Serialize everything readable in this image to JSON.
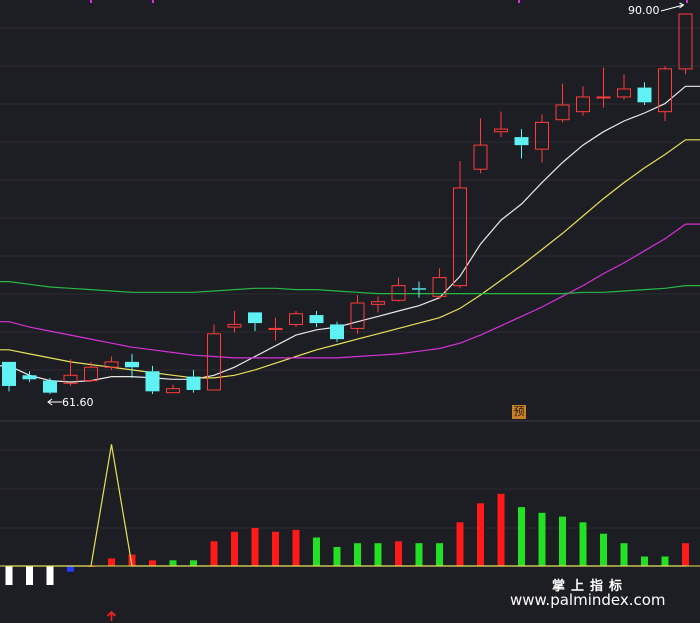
{
  "chart_data": {
    "type": "candlestick",
    "price_range": [
      60,
      92
    ],
    "annotations": {
      "high_label": "90.00",
      "low_label": "61.60",
      "predict_badge": "预"
    },
    "candles": [
      {
        "o": 64.0,
        "c": 62.2,
        "h": 64.0,
        "l": 61.8
      },
      {
        "o": 63.0,
        "c": 62.7,
        "h": 63.3,
        "l": 62.5
      },
      {
        "o": 62.6,
        "c": 61.7,
        "h": 62.8,
        "l": 61.6
      },
      {
        "o": 62.4,
        "c": 63.0,
        "h": 64.2,
        "l": 62.2
      },
      {
        "o": 62.6,
        "c": 63.6,
        "h": 64.0,
        "l": 62.5
      },
      {
        "o": 63.6,
        "c": 64.0,
        "h": 64.4,
        "l": 63.4
      },
      {
        "o": 64.0,
        "c": 63.6,
        "h": 64.6,
        "l": 62.8
      },
      {
        "o": 63.3,
        "c": 61.8,
        "h": 63.7,
        "l": 61.6
      },
      {
        "o": 61.7,
        "c": 62.0,
        "h": 62.3,
        "l": 61.7
      },
      {
        "o": 62.9,
        "c": 61.9,
        "h": 63.4,
        "l": 61.7
      },
      {
        "o": 61.9,
        "c": 66.1,
        "h": 66.8,
        "l": 61.9
      },
      {
        "o": 66.6,
        "c": 66.8,
        "h": 67.8,
        "l": 66.2
      },
      {
        "o": 67.7,
        "c": 66.9,
        "h": 67.7,
        "l": 66.3
      },
      {
        "o": 66.5,
        "c": 66.5,
        "h": 67.3,
        "l": 65.6
      },
      {
        "o": 66.8,
        "c": 67.6,
        "h": 67.8,
        "l": 66.6
      },
      {
        "o": 67.5,
        "c": 66.9,
        "h": 67.8,
        "l": 66.6
      },
      {
        "o": 66.8,
        "c": 65.7,
        "h": 67.0,
        "l": 65.5
      },
      {
        "o": 66.5,
        "c": 68.4,
        "h": 69.0,
        "l": 66.1
      },
      {
        "o": 68.3,
        "c": 68.5,
        "h": 68.9,
        "l": 67.7
      },
      {
        "o": 68.6,
        "c": 69.7,
        "h": 70.3,
        "l": 68.5
      },
      {
        "o": 69.5,
        "c": 69.4,
        "h": 70.0,
        "l": 68.8
      },
      {
        "o": 68.9,
        "c": 70.3,
        "h": 71.0,
        "l": 68.7
      },
      {
        "o": 69.7,
        "c": 77.0,
        "h": 79.0,
        "l": 69.5
      },
      {
        "o": 78.4,
        "c": 80.2,
        "h": 82.2,
        "l": 78.1
      },
      {
        "o": 81.2,
        "c": 81.4,
        "h": 82.7,
        "l": 80.8
      },
      {
        "o": 80.8,
        "c": 80.2,
        "h": 81.4,
        "l": 79.2
      },
      {
        "o": 79.9,
        "c": 81.9,
        "h": 82.5,
        "l": 78.9
      },
      {
        "o": 82.1,
        "c": 83.2,
        "h": 84.8,
        "l": 81.9
      },
      {
        "o": 82.7,
        "c": 83.8,
        "h": 84.6,
        "l": 82.4
      },
      {
        "o": 83.8,
        "c": 83.8,
        "h": 86.0,
        "l": 83.0
      },
      {
        "o": 83.8,
        "c": 84.4,
        "h": 85.5,
        "l": 83.6
      },
      {
        "o": 84.5,
        "c": 83.4,
        "h": 84.9,
        "l": 83.2
      },
      {
        "o": 82.7,
        "c": 85.9,
        "h": 86.1,
        "l": 82.0
      },
      {
        "o": 85.9,
        "c": 90.0,
        "h": 90.0,
        "l": 85.5
      }
    ],
    "ma_lines": [
      {
        "color": "#e8e8e8",
        "values": [
          63.7,
          63.0,
          62.6,
          62.5,
          62.6,
          62.9,
          62.9,
          62.8,
          62.7,
          62.7,
          63.0,
          63.6,
          64.4,
          65.2,
          66.0,
          66.4,
          66.6,
          67.0,
          67.4,
          67.8,
          68.2,
          68.8,
          70.4,
          72.8,
          74.6,
          75.8,
          77.4,
          78.9,
          80.2,
          81.2,
          82.0,
          82.6,
          83.3,
          84.6
        ]
      },
      {
        "color": "#e6e05a",
        "values": [
          64.9,
          64.6,
          64.3,
          64.0,
          63.8,
          63.6,
          63.4,
          63.2,
          63.0,
          62.8,
          62.8,
          63.0,
          63.4,
          63.9,
          64.4,
          64.9,
          65.3,
          65.7,
          66.1,
          66.5,
          66.9,
          67.3,
          68.0,
          69.0,
          70.1,
          71.2,
          72.4,
          73.6,
          74.9,
          76.2,
          77.4,
          78.5,
          79.5,
          80.6
        ]
      },
      {
        "color": "#d531d8",
        "values": [
          67.0,
          66.6,
          66.3,
          66.0,
          65.7,
          65.4,
          65.1,
          64.9,
          64.7,
          64.5,
          64.4,
          64.3,
          64.3,
          64.3,
          64.3,
          64.3,
          64.3,
          64.4,
          64.5,
          64.6,
          64.8,
          65.0,
          65.4,
          66.0,
          66.7,
          67.4,
          68.1,
          68.9,
          69.7,
          70.6,
          71.4,
          72.3,
          73.2,
          74.3
        ]
      },
      {
        "color": "#27b844",
        "values": [
          70.0,
          69.8,
          69.6,
          69.5,
          69.4,
          69.3,
          69.2,
          69.2,
          69.2,
          69.2,
          69.3,
          69.4,
          69.5,
          69.5,
          69.4,
          69.4,
          69.3,
          69.2,
          69.1,
          69.1,
          69.1,
          69.1,
          69.1,
          69.1,
          69.1,
          69.1,
          69.1,
          69.1,
          69.2,
          69.2,
          69.3,
          69.4,
          69.5,
          69.7
        ]
      }
    ],
    "indicator": {
      "range": [
        -1,
        7
      ],
      "bars": [
        -1,
        -1,
        -1,
        -0.3,
        0,
        0.4,
        0.6,
        0.3,
        0.3,
        0.3,
        1.3,
        1.8,
        2.0,
        1.8,
        1.9,
        1.5,
        1.0,
        1.2,
        1.2,
        1.3,
        1.2,
        1.2,
        2.3,
        3.3,
        3.8,
        3.1,
        2.8,
        2.6,
        2.3,
        1.7,
        1.2,
        0.5,
        0.5,
        1.2
      ],
      "bar_colors": [
        "#ffffff",
        "#ffffff",
        "#ffffff",
        "#1f3cff",
        "#ff1a1a",
        "#ff1a1a",
        "#ff1a1a",
        "#ff1a1a",
        "#22e022",
        "#22e022",
        "#ff1a1a",
        "#ff1a1a",
        "#ff1a1a",
        "#ff1a1a",
        "#ff1a1a",
        "#22e022",
        "#22e022",
        "#22e022",
        "#22e022",
        "#ff1a1a",
        "#22e022",
        "#22e022",
        "#ff1a1a",
        "#ff1a1a",
        "#ff1a1a",
        "#22e022",
        "#22e022",
        "#22e022",
        "#22e022",
        "#22e022",
        "#22e022",
        "#22e022",
        "#22e022",
        "#ff1a1a"
      ],
      "yellow_line": {
        "color": "#e6e05a",
        "values": [
          0,
          0,
          0,
          0,
          0,
          6.4,
          0,
          0,
          0,
          0,
          0,
          0,
          0,
          0,
          0,
          0,
          0,
          0,
          0,
          0,
          0,
          0,
          0,
          0,
          0,
          0,
          0,
          0,
          0,
          0,
          0,
          0,
          0,
          0
        ]
      },
      "signal_arrow_index": 5
    }
  },
  "watermark": {
    "cn": "掌上指标",
    "url": "www.palmindex.com"
  }
}
